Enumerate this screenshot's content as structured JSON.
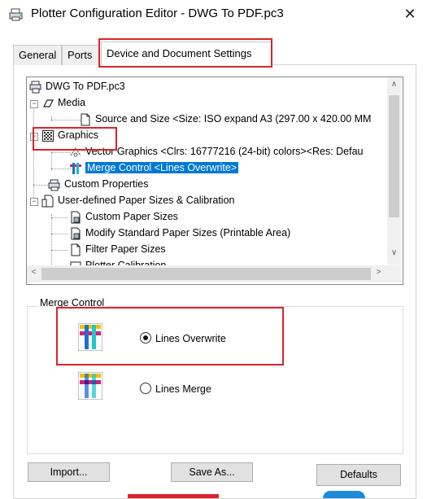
{
  "window": {
    "title": "Plotter Configuration Editor - DWG To PDF.pc3",
    "close_glyph": "✕"
  },
  "tabs": [
    {
      "label": "General"
    },
    {
      "label": "Ports"
    },
    {
      "label": "Device and Document Settings",
      "active": true
    }
  ],
  "tree": {
    "items": [
      {
        "label": "DWG To PDF.pc3",
        "icon": "plotter-config-icon"
      },
      {
        "label": "Media",
        "icon": "media-icon",
        "expander": "−"
      },
      {
        "label": "Source and Size <Size: ISO expand A3 (297.00 x 420.00 MM",
        "icon": "page-icon"
      },
      {
        "label": "Graphics",
        "icon": "graphics-icon",
        "expander": "−"
      },
      {
        "label": "Vector Graphics <Clrs: 16777216  (24-bit) colors><Res: Defau",
        "icon": "vector-graphics-icon"
      },
      {
        "label": "Merge Control <Lines Overwrite>",
        "icon": "merge-control-icon",
        "selected": true
      },
      {
        "label": "Custom Properties",
        "icon": "custom-properties-icon"
      },
      {
        "label": "User-defined Paper Sizes & Calibration",
        "icon": "paper-sizes-icon",
        "expander": "−"
      },
      {
        "label": "Custom Paper Sizes",
        "icon": "custom-paper-icon"
      },
      {
        "label": "Modify Standard Paper Sizes (Printable Area)",
        "icon": "modify-paper-icon"
      },
      {
        "label": "Filter Paper Sizes",
        "icon": "filter-paper-icon"
      },
      {
        "label": "Plotter Calibration",
        "icon": "calibration-icon"
      }
    ],
    "scroll_up": "∧",
    "scroll_down": "∨",
    "scroll_left": "<",
    "scroll_right": ">"
  },
  "merge_control": {
    "group_label": "Merge Control",
    "options": [
      {
        "label": "Lines Overwrite",
        "checked": true,
        "icon": "lines-overwrite-icon"
      },
      {
        "label": "Lines Merge",
        "checked": false,
        "icon": "lines-merge-icon"
      }
    ]
  },
  "buttons": {
    "import": "Import...",
    "save_as": "Save As...",
    "defaults": "Defaults"
  },
  "colors": {
    "highlight": "#d9252b",
    "selection": "#0078d7"
  }
}
